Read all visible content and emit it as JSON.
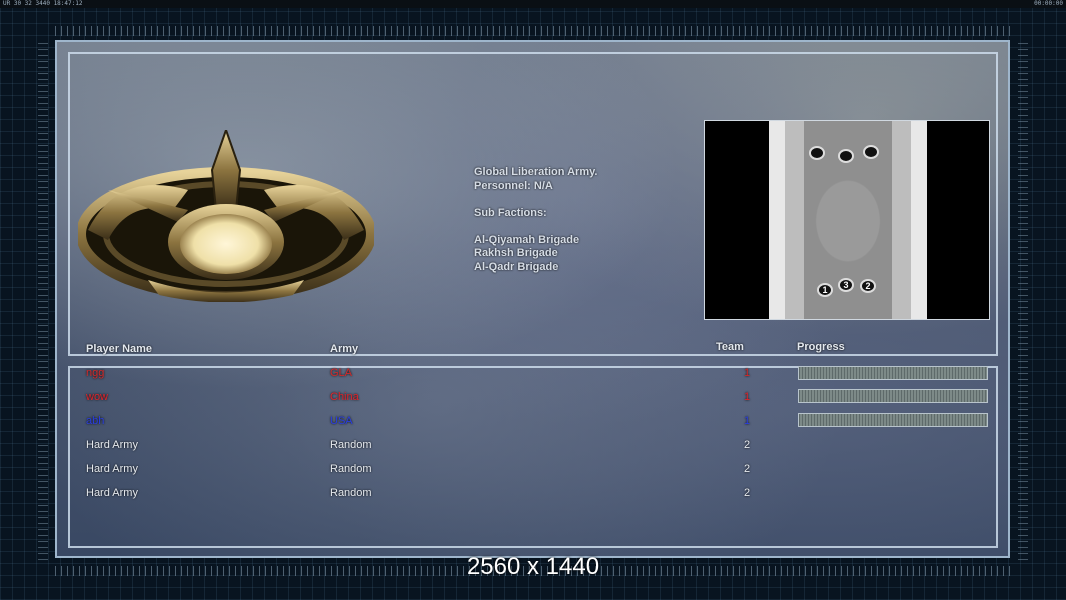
{
  "topbar": {
    "left_text": "UR 30 32 3440 18:47:12",
    "right_text": "00:00:00"
  },
  "faction": {
    "name": "Global Liberation Army.",
    "personnel": "Personnel: N/A",
    "sub_factions_label": "Sub Factions:",
    "sub_factions": [
      "Al-Qiyamah Brigade",
      "Rakhsh Brigade",
      "Al-Qadr Brigade"
    ]
  },
  "minimap": {
    "start_labels": [
      "1",
      "3",
      "2"
    ]
  },
  "table": {
    "headers": {
      "player": "Player Name",
      "army": "Army",
      "team": "Team",
      "progress": "Progress"
    },
    "rows": [
      {
        "name": "ngg",
        "army": "GLA",
        "team": "1",
        "color": "#d22a2a",
        "progress": 0
      },
      {
        "name": "wow",
        "army": "China",
        "team": "1",
        "color": "#e0242a",
        "progress": 0
      },
      {
        "name": "abh",
        "army": "USA",
        "team": "1",
        "color": "#2a3ee0",
        "progress": 0
      },
      {
        "name": "Hard Army",
        "army": "Random",
        "team": "2",
        "color": "#e6eaef"
      },
      {
        "name": "Hard Army",
        "army": "Random",
        "team": "2",
        "color": "#e6eaef"
      },
      {
        "name": "Hard Army",
        "army": "Random",
        "team": "2",
        "color": "#e6eaef"
      }
    ]
  },
  "watermark": "2560 x 1440"
}
